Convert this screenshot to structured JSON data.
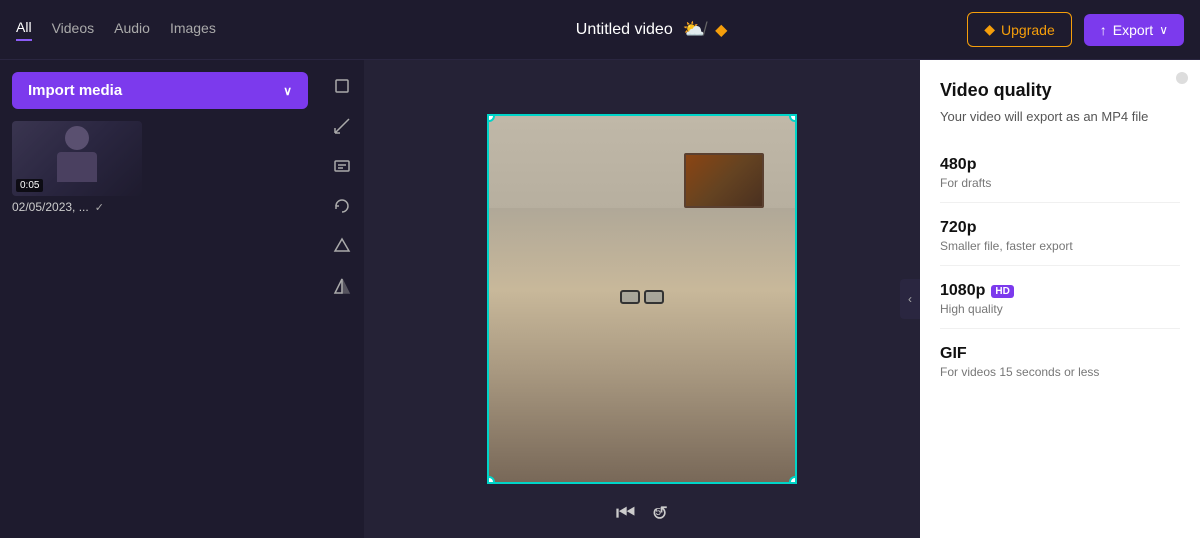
{
  "topbar": {
    "nav_all": "All",
    "nav_videos": "Videos",
    "nav_audio": "Audio",
    "nav_images": "Images",
    "video_title": "Untitled video",
    "upgrade_label": "Upgrade",
    "export_label": "Export",
    "diamond_icon": "◆",
    "upload_icon": "↑",
    "chevron_icon": "∨",
    "cloud_slash": "⛅"
  },
  "sidebar": {
    "import_label": "Import media",
    "media_items": [
      {
        "timestamp": "0:05",
        "label": "02/05/2023, ...",
        "checked": true
      }
    ]
  },
  "toolbar": {
    "tools": [
      {
        "name": "crop-tool",
        "icon": "⊡"
      },
      {
        "name": "trim-tool",
        "icon": "⌐"
      },
      {
        "name": "caption-tool",
        "icon": "⬜"
      },
      {
        "name": "rotate-tool",
        "icon": "↺"
      },
      {
        "name": "filter-tool",
        "icon": "△"
      },
      {
        "name": "flip-tool",
        "icon": "◁"
      }
    ]
  },
  "quality_panel": {
    "title": "Video quality",
    "subtitle": "Your video will export as an MP4 file",
    "options": [
      {
        "label": "480p",
        "description": "For drafts",
        "badge": null
      },
      {
        "label": "720p",
        "description": "Smaller file, faster export",
        "badge": null
      },
      {
        "label": "1080p",
        "description": "High quality",
        "badge": "HD"
      },
      {
        "label": "GIF",
        "description": "For videos 15 seconds or less",
        "badge": null
      }
    ]
  },
  "playback": {
    "rewind_icon": "⏮",
    "replay5_icon": "↺5"
  }
}
